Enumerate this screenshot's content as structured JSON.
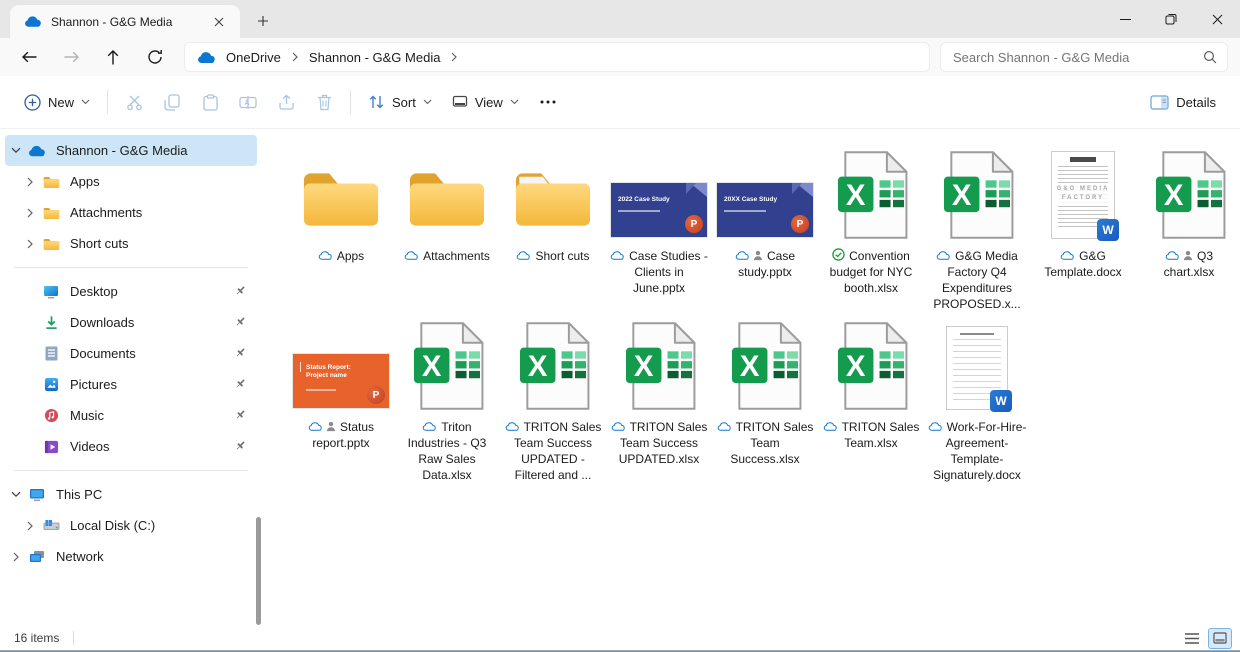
{
  "titlebar": {
    "tab_title": "Shannon - G&G Media"
  },
  "navbar": {
    "breadcrumb": {
      "root": "OneDrive",
      "current": "Shannon - G&G Media"
    },
    "search_placeholder": "Search Shannon - G&G Media"
  },
  "toolbar": {
    "new": "New",
    "sort": "Sort",
    "view": "View",
    "details": "Details"
  },
  "sidebar": {
    "root": "Shannon - G&G Media",
    "folders": [
      {
        "label": "Apps"
      },
      {
        "label": "Attachments"
      },
      {
        "label": "Short cuts"
      }
    ],
    "quick": [
      {
        "label": "Desktop"
      },
      {
        "label": "Downloads"
      },
      {
        "label": "Documents"
      },
      {
        "label": "Pictures"
      },
      {
        "label": "Music"
      },
      {
        "label": "Videos"
      }
    ],
    "system": [
      {
        "label": "This PC"
      },
      {
        "label": "Local Disk (C:)"
      },
      {
        "label": "Network"
      }
    ]
  },
  "files": [
    {
      "type": "folder",
      "name": "Apps",
      "badges": [
        "cloud"
      ]
    },
    {
      "type": "folder",
      "name": "Attachments",
      "badges": [
        "cloud"
      ]
    },
    {
      "type": "folder",
      "name": "Short cuts",
      "badges": [
        "cloud"
      ]
    },
    {
      "type": "pptx",
      "name": "Case Studies - Clients in June.pptx",
      "badges": [
        "cloud"
      ],
      "thumb_title": "2022 Case Study"
    },
    {
      "type": "pptx",
      "name": "Case study.pptx",
      "badges": [
        "cloud",
        "person"
      ],
      "thumb_title": "20XX Case Study"
    },
    {
      "type": "xlsx",
      "name": "Convention budget for NYC booth.xlsx",
      "badges": [
        "check"
      ]
    },
    {
      "type": "xlsx",
      "name": "G&G Media Factory Q4 Expenditures PROPOSED.x...",
      "badges": [
        "cloud"
      ]
    },
    {
      "type": "docx",
      "name": "G&G Template.docx",
      "badges": [
        "cloud"
      ],
      "thumb_text": "G&G MEDIA FACTORY"
    },
    {
      "type": "xlsx",
      "name": "Q3 chart.xlsx",
      "badges": [
        "cloud",
        "person"
      ]
    },
    {
      "type": "pptx",
      "name": "Status report.pptx",
      "badges": [
        "cloud",
        "person"
      ],
      "thumb_title": "Status Report: Project name"
    },
    {
      "type": "xlsx",
      "name": "Triton Industries - Q3 Raw Sales Data.xlsx",
      "badges": [
        "cloud"
      ]
    },
    {
      "type": "xlsx",
      "name": "TRITON Sales Team Success UPDATED - Filtered and ...",
      "badges": [
        "cloud"
      ]
    },
    {
      "type": "xlsx",
      "name": "TRITON Sales Team Success UPDATED.xlsx",
      "badges": [
        "cloud"
      ]
    },
    {
      "type": "xlsx",
      "name": "TRITON Sales Team Success.xlsx",
      "badges": [
        "cloud"
      ]
    },
    {
      "type": "xlsx",
      "name": "TRITON Sales Team.xlsx",
      "badges": [
        "cloud"
      ]
    },
    {
      "type": "docx",
      "name": "Work-For-Hire-Agreement-Template-Signaturely.docx",
      "badges": [
        "cloud"
      ]
    }
  ],
  "statusbar": {
    "count": "16 items"
  },
  "colors": {
    "onedrive_blue": "#0d76d1",
    "excel_green": "#149b4e",
    "word_blue": "#185abd",
    "ppt_orange": "#c43e1c",
    "slide_blue": "#32418f",
    "slide_orange": "#e8622c",
    "folder_yellow": "#f6bf43",
    "selection_blue": "#cde6f7",
    "check_green": "#1a9c3e"
  }
}
